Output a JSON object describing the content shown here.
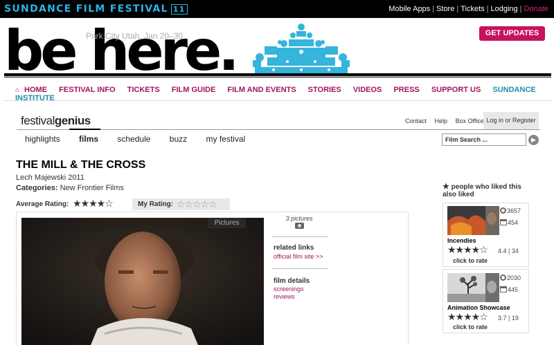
{
  "topbar": {
    "brand": "SUNDANCE FILM FESTIVAL",
    "brand_edition": "11",
    "links": [
      "Mobile Apps",
      "Store",
      "Tickets",
      "Lodging"
    ],
    "donate": "Donate"
  },
  "header": {
    "tagline": "be here.",
    "dateline": "Park City Utah, Jan 20–30",
    "cta": "GET UPDATES"
  },
  "mainnav": {
    "items": [
      "HOME",
      "FESTIVAL INFO",
      "TICKETS",
      "FILM GUIDE",
      "FILM AND EVENTS",
      "STORIES",
      "VIDEOS",
      "PRESS",
      "SUPPORT US"
    ],
    "institute": "SUNDANCE INSTITUTE"
  },
  "genius": {
    "logo_a": "festival",
    "logo_b": "genius",
    "utility": [
      "Contact",
      "Help",
      "Box Office"
    ],
    "login": "Log in",
    "or": "or",
    "register": "Register",
    "tabs": [
      "highlights",
      "films",
      "schedule",
      "buzz",
      "my festival"
    ],
    "search_placeholder": "Film Search ..."
  },
  "film": {
    "title": "THE MILL & THE CROSS",
    "byline": "Lech Majewski 2011",
    "category_label": "Categories:",
    "category": "New Frontier Films",
    "avg_rating_label": "Average Rating:",
    "avg_rating_stars": 3.5,
    "my_rating_label": "My Rating:",
    "my_rating_stars": 0,
    "photo_label": "Pictures",
    "pictures_count": "3 pictures",
    "related_links_title": "related links",
    "related_links": [
      "official film site >>"
    ],
    "details_title": "film details",
    "details_links": [
      "screenings",
      "reviews"
    ]
  },
  "liked": {
    "heading": "people who liked this also liked",
    "click_to_rate": "click to rate",
    "films": [
      {
        "title": "Incendies",
        "views": "3657",
        "screenings": "454",
        "score": "4.4 | 34",
        "stars": 4.4
      },
      {
        "title": "Animation Showcase",
        "views": "2030",
        "screenings": "445",
        "score": "3.7 | 19",
        "stars": 3.7
      }
    ]
  },
  "colors": {
    "brand_blue": "#2bb3e6",
    "magenta": "#a3135b",
    "cta": "#c7125e",
    "institute": "#1c8fa8"
  }
}
